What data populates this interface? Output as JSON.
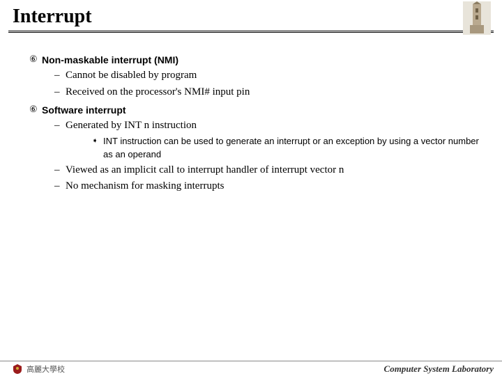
{
  "title": "Interrupt",
  "items": [
    {
      "label": "Non-maskable interrupt (NMI)",
      "sub": [
        {
          "text": "Cannot be disabled by program"
        },
        {
          "text": "Received on the processor's NMI# input pin"
        }
      ]
    },
    {
      "label": "Software interrupt",
      "sub": [
        {
          "text": "Generated by INT n instruction",
          "sub": [
            {
              "text": "INT instruction can be used to generate an interrupt or an exception by using a vector number as an operand"
            }
          ]
        },
        {
          "text": "Viewed as an implicit call to interrupt handler of interrupt vector n"
        },
        {
          "text": "No mechanism for masking interrupts"
        }
      ]
    }
  ],
  "footer_left": "高麗大學校",
  "footer_right": "Computer System Laboratory",
  "marks": {
    "l1": "⑥",
    "l2": "–",
    "l3": "➧"
  }
}
